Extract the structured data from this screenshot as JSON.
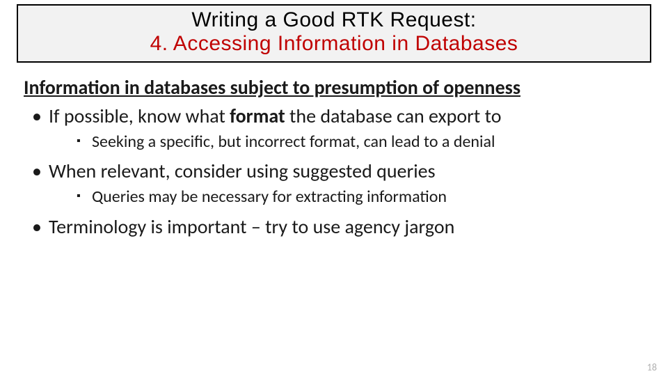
{
  "title": {
    "line1": "Writing a Good RTK Request:",
    "line2": "4. Accessing Information in Databases"
  },
  "heading": "Information in databases subject to presumption of openness",
  "bullets": {
    "b1_pre": "If possible, know what ",
    "b1_bold": "format",
    "b1_post": " the database can export to",
    "b1_sub": "Seeking a specific, but incorrect format, can lead to a denial",
    "b2": "When relevant, consider using suggested queries",
    "b2_sub": "Queries may be necessary for extracting information",
    "b3": "Terminology is important – try to use agency jargon"
  },
  "page_number": "18"
}
